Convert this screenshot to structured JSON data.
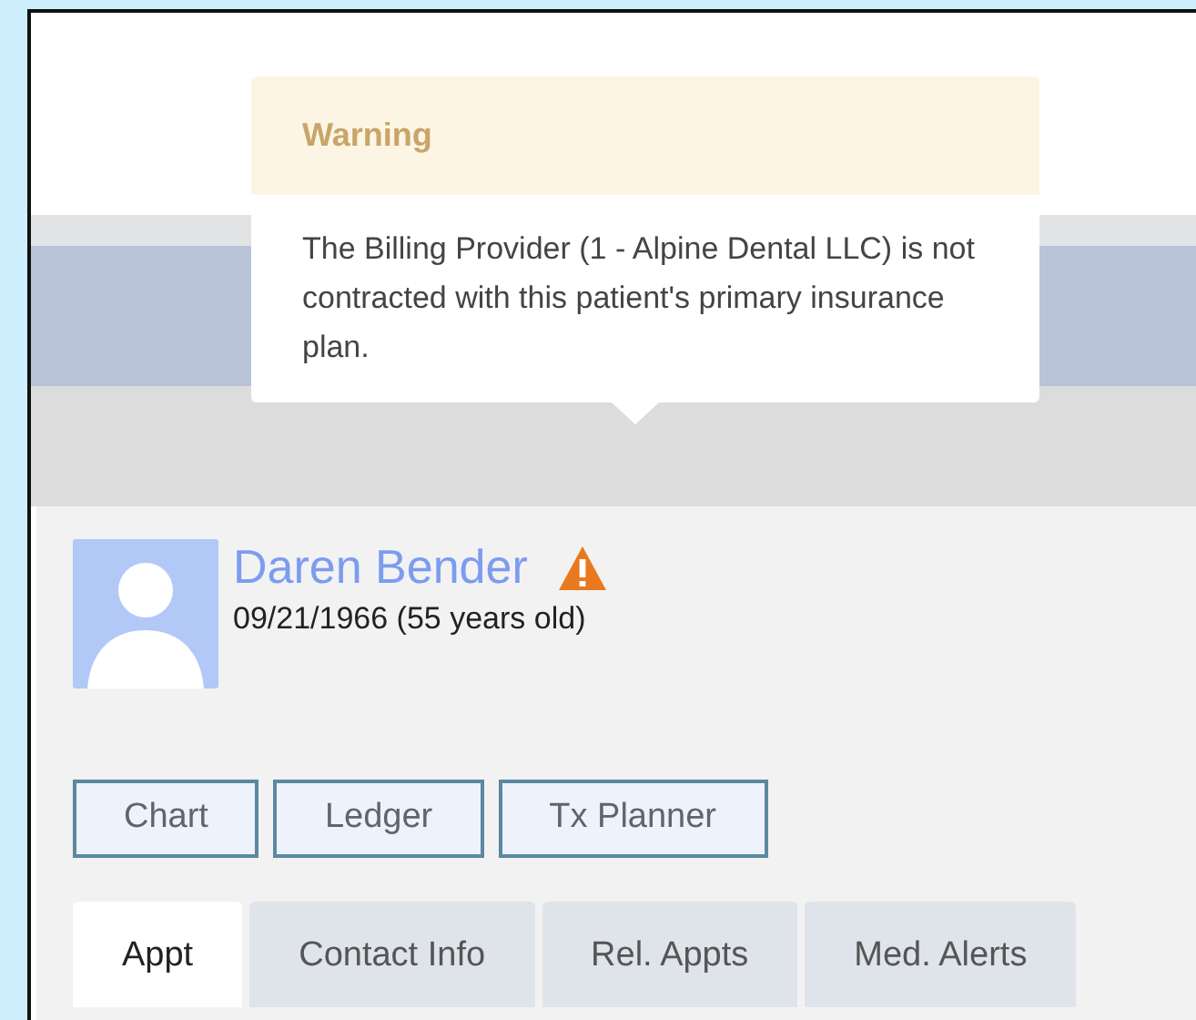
{
  "tooltip": {
    "title": "Warning",
    "message": "The Billing Provider (1 - Alpine Dental LLC) is not contracted with this patient's primary insurance plan."
  },
  "patient": {
    "name": "Daren Bender",
    "dob": "09/21/1966 (55 years old)",
    "warning": true
  },
  "buttons": [
    "Chart",
    "Ledger",
    "Tx Planner"
  ],
  "tabs": [
    {
      "label": "Appt",
      "selected": true
    },
    {
      "label": "Contact Info",
      "selected": false
    },
    {
      "label": "Rel. Appts",
      "selected": false
    },
    {
      "label": "Med. Alerts",
      "selected": false
    }
  ]
}
